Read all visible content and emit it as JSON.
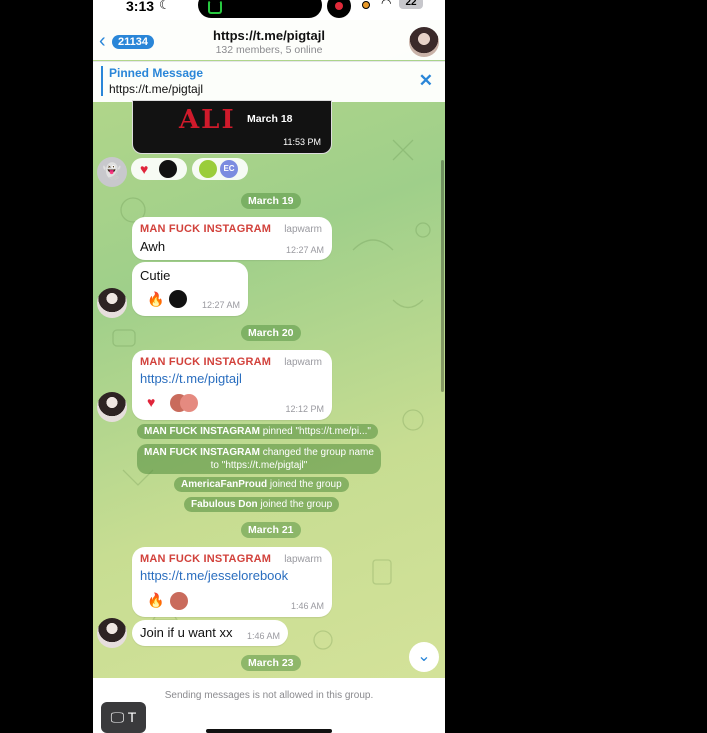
{
  "status": {
    "time": "3:13",
    "battery": "22"
  },
  "header": {
    "back_count": "21134",
    "title": "https://t.me/pigtajl",
    "subtitle": "132 members, 5 online"
  },
  "pinned": {
    "title": "Pinned Message",
    "text": "https://t.me/pigtajl"
  },
  "media": {
    "date": "March 18",
    "time": "11:53 PM",
    "art": "ALI"
  },
  "reaction_badge": "EC",
  "dates": [
    "March 19",
    "March 20",
    "March 21",
    "March 23"
  ],
  "messages": [
    {
      "sender": "MAN FUCK INSTAGRAM",
      "tag": "lapwarm",
      "text": "Awh",
      "time": "12:27 AM"
    },
    {
      "text": "Cutie",
      "time": "12:27 AM"
    },
    {
      "sender": "MAN FUCK INSTAGRAM",
      "tag": "lapwarm",
      "text": "https://t.me/pigtajl",
      "time": "12:12 PM"
    },
    {
      "sender": "MAN FUCK INSTAGRAM",
      "tag": "lapwarm",
      "text": "https://t.me/jesselorebook",
      "time": "1:46 AM"
    },
    {
      "text": "Join if u want xx",
      "time": "1:46 AM"
    }
  ],
  "service": [
    {
      "actor": "MAN FUCK INSTAGRAM",
      "text": " pinned \"https://t.me/pi...\""
    },
    {
      "actor": "MAN FUCK INSTAGRAM",
      "text": " changed the group name",
      "line2": "to \"https://t.me/pigtajl\""
    },
    {
      "actor": "AmericaFanProud",
      "text": " joined the group"
    },
    {
      "actor": "Fabulous Don",
      "text": " joined the group"
    }
  ],
  "footer": {
    "text": "Sending messages is not allowed in this group."
  },
  "overlay": {
    "label": "T"
  },
  "colors": {
    "accent": "#2a86d8",
    "sender": "#d2423c",
    "heart": "#e0243a"
  }
}
